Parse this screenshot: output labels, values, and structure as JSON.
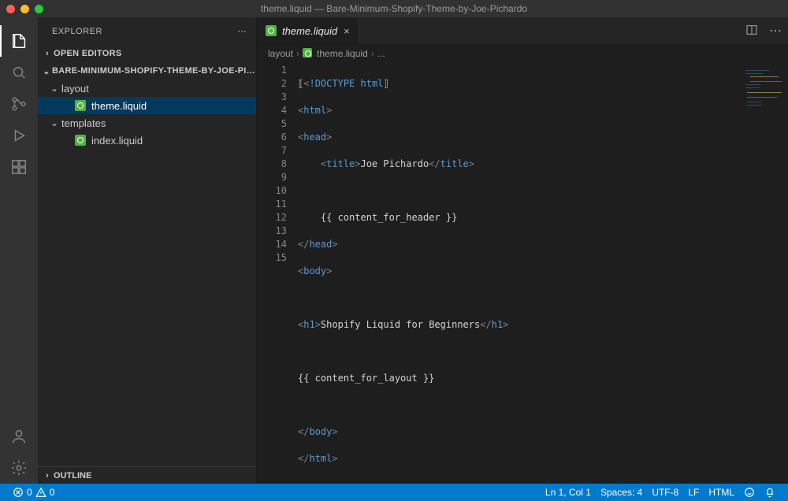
{
  "title": "theme.liquid — Bare-Minimum-Shopify-Theme-by-Joe-Pichardo",
  "sidebar": {
    "title": "EXPLORER",
    "sections": {
      "open_editors": "OPEN EDITORS",
      "project": "BARE-MINIMUM-SHOPIFY-THEME-BY-JOE-PICHARDO",
      "outline": "OUTLINE"
    },
    "tree": {
      "folder_layout": "layout",
      "file_theme": "theme.liquid",
      "folder_templates": "templates",
      "file_index": "index.liquid"
    }
  },
  "tabs": {
    "active": "theme.liquid"
  },
  "breadcrumb": {
    "seg1": "layout",
    "seg2": "theme.liquid",
    "seg3": "..."
  },
  "code": {
    "r1_a": "<",
    "r1_b": "!DOCTYPE ",
    "r1_c": "html",
    "r1_d": ">",
    "r2_a": "<",
    "r2_b": "html",
    "r2_c": ">",
    "r3_a": "<",
    "r3_b": "head",
    "r3_c": ">",
    "r4_a": "    <",
    "r4_b": "title",
    "r4_c": ">",
    "r4_d": "Joe Pichardo",
    "r4_e": "</",
    "r4_f": "title",
    "r4_g": ">",
    "r5": "",
    "r6": "    {{ content_for_header }}",
    "r7_a": "</",
    "r7_b": "head",
    "r7_c": ">",
    "r8_a": "<",
    "r8_b": "body",
    "r8_c": ">",
    "r9": "",
    "r10_a": "<",
    "r10_b": "h1",
    "r10_c": ">",
    "r10_d": "Shopify Liquid for Beginners",
    "r10_e": "</",
    "r10_f": "h1",
    "r10_g": ">",
    "r11": "",
    "r12": "{{ content_for_layout }}",
    "r13": "",
    "r14_a": "</",
    "r14_b": "body",
    "r14_c": ">",
    "r15_a": "</",
    "r15_b": "html",
    "r15_c": ">"
  },
  "status": {
    "errors": "0",
    "warnings": "0",
    "cursor": "Ln 1, Col 1",
    "spaces": "Spaces: 4",
    "encoding": "UTF-8",
    "eol": "LF",
    "lang": "HTML"
  }
}
